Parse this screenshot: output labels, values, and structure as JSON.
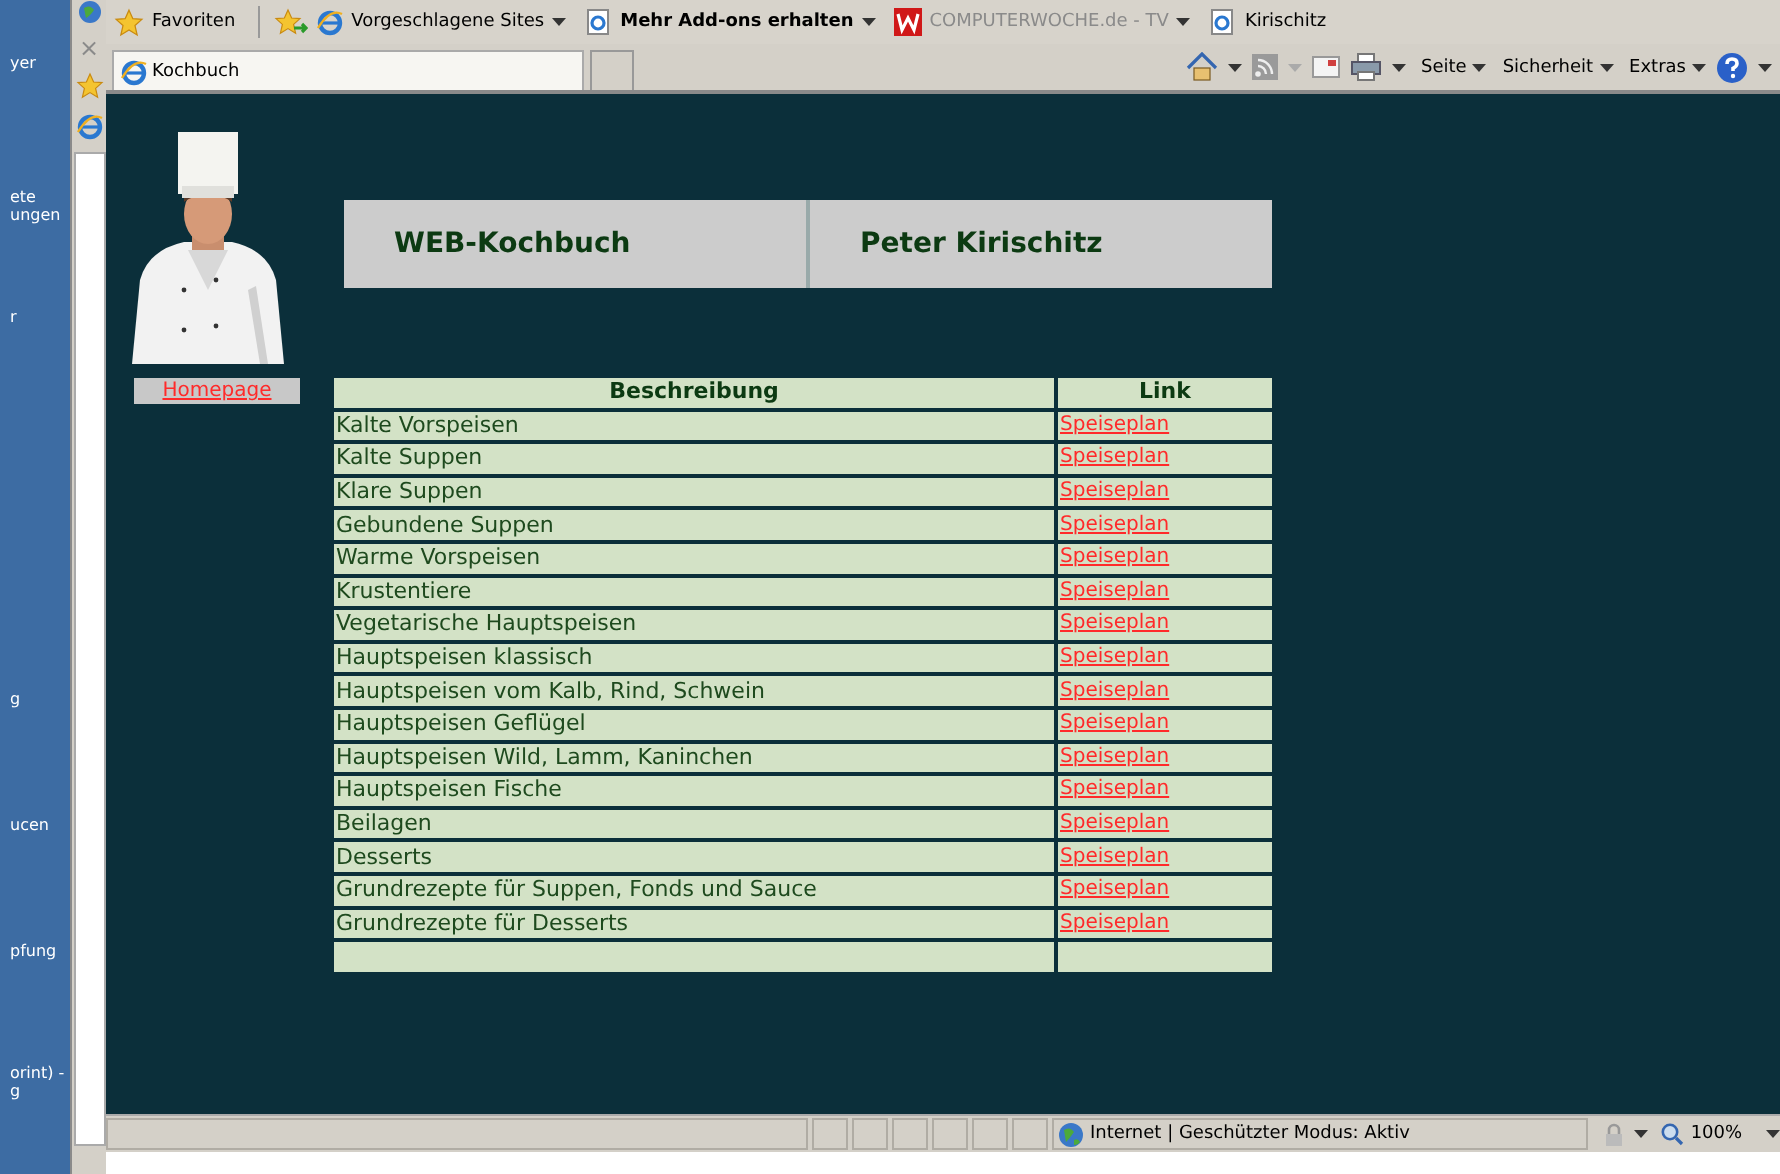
{
  "left_panel": {
    "fragments": [
      "yer",
      "ete",
      "ungen",
      "r",
      "g",
      "ucen",
      "pfung",
      "orint) -",
      "g"
    ]
  },
  "side_strip": {
    "close": "×"
  },
  "favorites_bar": {
    "favorites": "Favoriten",
    "links": [
      {
        "kind": "ie",
        "label": "Vorgeschlagene Sites",
        "dropdown": true,
        "bold": false,
        "dim": false
      },
      {
        "kind": "page",
        "label": "Mehr Add-ons erhalten",
        "dropdown": true,
        "bold": true,
        "dim": false
      },
      {
        "kind": "logo",
        "label": "COMPUTERWOCHE.de - TV",
        "dropdown": true,
        "bold": false,
        "dim": true
      },
      {
        "kind": "page",
        "label": "Kirischitz",
        "dropdown": false,
        "bold": false,
        "dim": false
      }
    ]
  },
  "tabs": [
    {
      "label": "Kochbuch",
      "selected": true
    }
  ],
  "command_bar": {
    "menus": [
      "Seite",
      "Sicherheit",
      "Extras"
    ]
  },
  "page": {
    "picture": {
      "kind": "picture"
    },
    "homepage_link": "Homepage",
    "header": [
      "WEB-Kochbuch",
      "Peter Kirischitz"
    ],
    "table": {
      "columns": [
        "Beschreibung",
        "Link"
      ],
      "rows": [
        {
          "description": "Kalte Vorspeisen",
          "link": "Speiseplan"
        },
        {
          "description": "Kalte Suppen",
          "link": "Speiseplan"
        },
        {
          "description": "Klare Suppen",
          "link": "Speiseplan"
        },
        {
          "description": "Gebundene Suppen",
          "link": "Speiseplan"
        },
        {
          "description": "Warme Vorspeisen",
          "link": "Speiseplan"
        },
        {
          "description": "Krustentiere",
          "link": "Speiseplan"
        },
        {
          "description": "Vegetarische Hauptspeisen",
          "link": "Speiseplan"
        },
        {
          "description": "Hauptspeisen klassisch",
          "link": "Speiseplan"
        },
        {
          "description": "Hauptspeisen vom Kalb, Rind, Schwein",
          "link": "Speiseplan"
        },
        {
          "description": "Hauptspeisen Geflügel",
          "link": "Speiseplan"
        },
        {
          "description": "Hauptspeisen Wild, Lamm, Kaninchen",
          "link": "Speiseplan"
        },
        {
          "description": "Hauptspeisen Fische",
          "link": "Speiseplan"
        },
        {
          "description": "Beilagen",
          "link": "Speiseplan"
        },
        {
          "description": "Desserts",
          "link": "Speiseplan"
        },
        {
          "description": "Grundrezepte für Suppen, Fonds und Sauce",
          "link": "Speiseplan"
        },
        {
          "description": "Grundrezepte für Desserts",
          "link": "Speiseplan"
        },
        {
          "description": "",
          "link": ""
        }
      ]
    }
  },
  "status_bar": {
    "zone": "Internet | Geschützter Modus: Aktiv",
    "zoom": "100%"
  }
}
